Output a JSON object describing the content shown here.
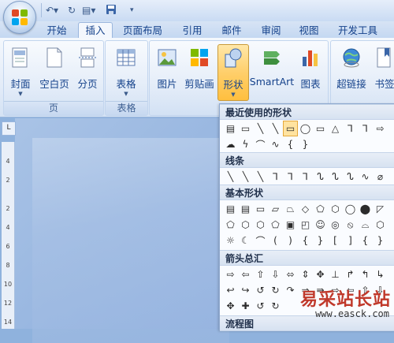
{
  "quick_access": {
    "undo_icon": "undo-icon",
    "redo_icon": "redo-icon",
    "format_icon": "format-icon",
    "save_icon": "save-icon",
    "customize_icon": "customize-icon"
  },
  "tabs": [
    "开始",
    "插入",
    "页面布局",
    "引用",
    "邮件",
    "审阅",
    "视图",
    "开发工具"
  ],
  "active_tab": "插入",
  "ribbon": {
    "groups": {
      "pages": {
        "label": "页",
        "buttons": [
          "封面",
          "空白页",
          "分页"
        ]
      },
      "table": {
        "label": "表格",
        "buttons": [
          "表格"
        ]
      },
      "illustrations": {
        "buttons": [
          "图片",
          "剪贴画",
          "形状",
          "SmartArt",
          "图表"
        ]
      },
      "links": {
        "buttons": [
          "超链接",
          "书签"
        ]
      }
    }
  },
  "ruler": {
    "corner": "L",
    "numbers": [
      "4",
      "2",
      "2",
      "4",
      "6",
      "8",
      "10",
      "12",
      "14"
    ]
  },
  "shapes_panel": {
    "sections": [
      "最近使用的形状",
      "线条",
      "基本形状",
      "箭头总汇",
      "流程图"
    ],
    "recent_row1": [
      "▤",
      "▭",
      "╲",
      "╲",
      "▭",
      "◯",
      "▭",
      "△",
      "⅂",
      "⅂",
      "⇨"
    ],
    "recent_row2": [
      "☁",
      "ϟ",
      "⌒",
      "∿",
      "{",
      "}"
    ],
    "lines_row": [
      "╲",
      "╲",
      "╲",
      "⅂",
      "⅂",
      "⅂",
      "ᔐ",
      "ᔐ",
      "ᔐ",
      "∿",
      "⌀",
      "✎"
    ],
    "basic_row1": [
      "▤",
      "▤",
      "▭",
      "▱",
      "⏢",
      "◇",
      "⬠",
      "⬡",
      "◯",
      "⬤",
      "◸",
      "◺"
    ],
    "basic_row2": [
      "⬠",
      "⬡",
      "⬡",
      "⬠",
      "▣",
      "◰",
      "☺",
      "◎",
      "⦸",
      "⌓",
      "⬡",
      "⬠"
    ],
    "basic_row3": [
      "☼",
      "☾",
      "⌒",
      "(",
      ")",
      "{",
      "}",
      "[",
      "]",
      "{",
      "}"
    ],
    "arrows_row1": [
      "⇨",
      "⇦",
      "⇧",
      "⇩",
      "⬄",
      "⇕",
      "✥",
      "⊥",
      "↱",
      "↰",
      "↳",
      "↩"
    ],
    "arrows_row2": [
      "↩",
      "↪",
      "↺",
      "↻",
      "↷",
      "⇒",
      "⇛",
      "⇨",
      "⇦",
      "⇧",
      "⇩",
      "⇳"
    ],
    "arrows_row3": [
      "✥",
      "✚",
      "↺",
      "↻"
    ]
  },
  "watermark": {
    "line1": "易采站长站",
    "line2": "www.easck.com"
  }
}
